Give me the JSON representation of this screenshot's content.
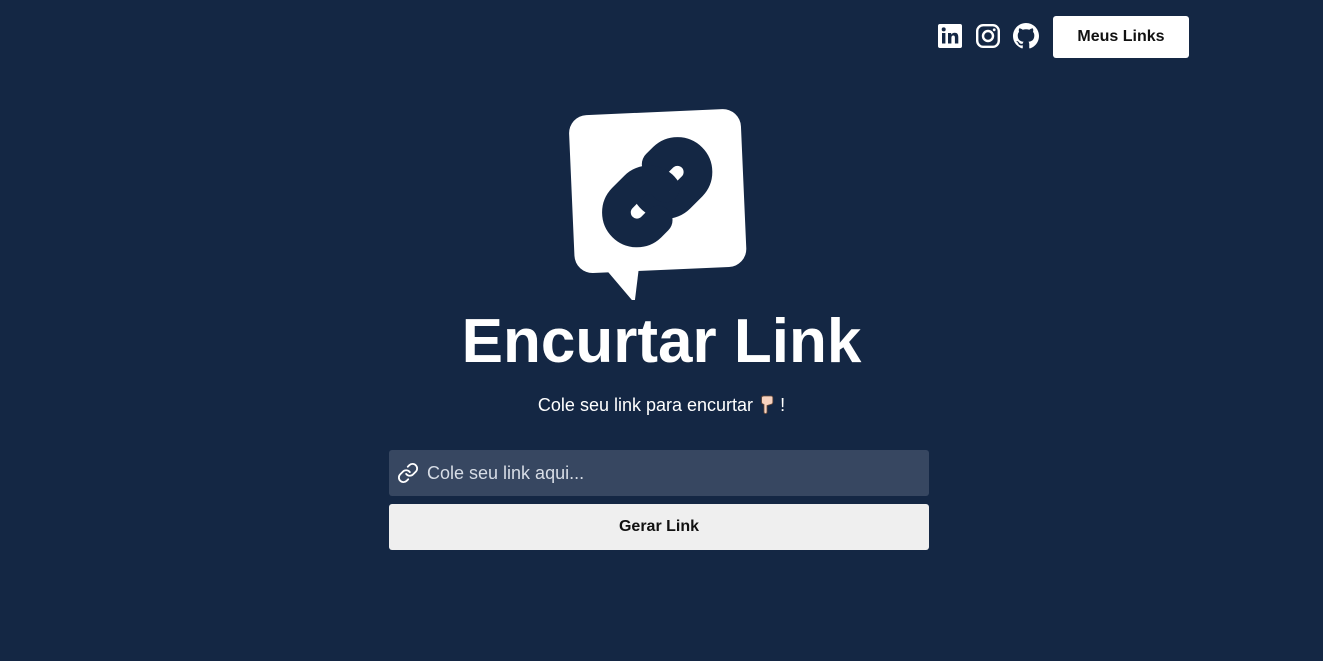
{
  "header": {
    "social_links": [
      {
        "icon": "linkedin-icon"
      },
      {
        "icon": "instagram-icon"
      },
      {
        "icon": "github-icon"
      }
    ],
    "my_links_label": "Meus Links"
  },
  "hero": {
    "logo_icon": "chat-bubble-link-icon",
    "title": "Encurtar Link",
    "subtitle": "Cole seu link para encurtar",
    "subtitle_suffix": "!",
    "subtitle_emoji": "pointing-down-hand-icon"
  },
  "form": {
    "input_icon": "link-icon",
    "input_value": "",
    "input_placeholder": "Cole seu link aqui...",
    "submit_label": "Gerar Link"
  },
  "colors": {
    "background": "#142744",
    "input_background": "#374761",
    "button_background": "#efefef",
    "text": "#ffffff"
  }
}
